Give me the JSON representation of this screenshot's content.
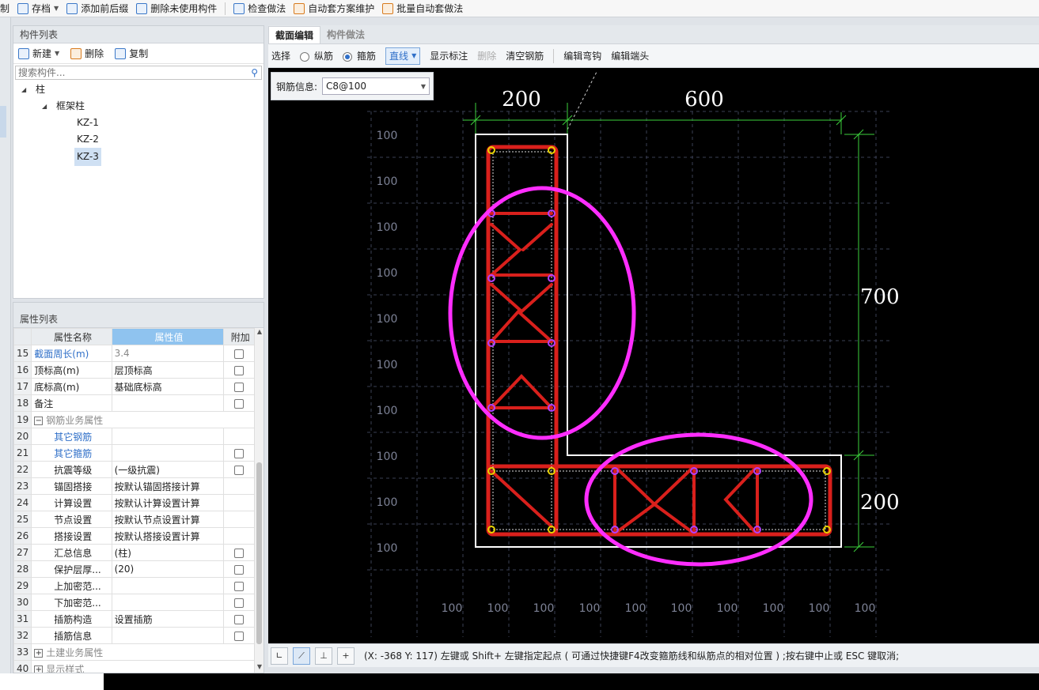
{
  "toolbar": {
    "items": [
      "制",
      "存档",
      "添加前后缀",
      "删除未使用构件",
      "检查做法",
      "自动套方案维护",
      "批量自动套做法"
    ]
  },
  "component_list": {
    "title": "构件列表",
    "new_label": "新建",
    "delete_label": "删除",
    "copy_label": "复制",
    "search_placeholder": "搜索构件...",
    "tree": {
      "root": "柱",
      "group": "框架柱",
      "items": [
        "KZ-1",
        "KZ-2",
        "KZ-3"
      ],
      "selected": "KZ-3"
    }
  },
  "property_list": {
    "title": "属性列表",
    "col_name": "属性名称",
    "col_value": "属性值",
    "col_extra": "附加",
    "rows": [
      {
        "n": "15",
        "name": "截面周长(m)",
        "value": "3.4"
      },
      {
        "n": "16",
        "name": "顶标高(m)",
        "value": "层顶标高"
      },
      {
        "n": "17",
        "name": "底标高(m)",
        "value": "基础底标高"
      },
      {
        "n": "18",
        "name": "备注",
        "value": ""
      },
      {
        "n": "19",
        "name": "钢筋业务属性",
        "value": ""
      },
      {
        "n": "20",
        "name": "其它钢筋",
        "value": ""
      },
      {
        "n": "21",
        "name": "其它箍筋",
        "value": ""
      },
      {
        "n": "22",
        "name": "抗震等级",
        "value": "(一级抗震)"
      },
      {
        "n": "23",
        "name": "锚固搭接",
        "value": "按默认锚固搭接计算"
      },
      {
        "n": "24",
        "name": "计算设置",
        "value": "按默认计算设置计算"
      },
      {
        "n": "25",
        "name": "节点设置",
        "value": "按默认节点设置计算"
      },
      {
        "n": "26",
        "name": "搭接设置",
        "value": "按默认搭接设置计算"
      },
      {
        "n": "27",
        "name": "汇总信息",
        "value": "(柱)"
      },
      {
        "n": "28",
        "name": "保护层厚...",
        "value": "(20)"
      },
      {
        "n": "29",
        "name": "上加密范...",
        "value": ""
      },
      {
        "n": "30",
        "name": "下加密范...",
        "value": ""
      },
      {
        "n": "31",
        "name": "插筋构造",
        "value": "设置插筋"
      },
      {
        "n": "32",
        "name": "插筋信息",
        "value": ""
      },
      {
        "n": "33",
        "name": "土建业务属性",
        "value": ""
      },
      {
        "n": "40",
        "name": "显示样式",
        "value": ""
      }
    ]
  },
  "tabs": {
    "section_edit": "截面编辑",
    "component_method": "构件做法"
  },
  "edit_bar": {
    "select": "选择",
    "longitudinal": "纵筋",
    "stirrup": "箍筋",
    "line_mode": "直线",
    "show_labels": "显示标注",
    "delete": "删除",
    "clear": "清空钢筋",
    "edit_hook": "编辑弯钩",
    "edit_end": "编辑端头"
  },
  "rebar_info": {
    "label": "钢筋信息:",
    "value": "C8@100"
  },
  "drawing": {
    "dim_top_left": "200",
    "dim_top_right": "600",
    "dim_right_top": "700",
    "dim_right_bottom": "200",
    "grid_label": "100"
  },
  "status": {
    "text": "(X: -368 Y: 117)  左键或 Shift+ 左键指定起点 ( 可通过快捷键F4改变箍筋线和纵筋点的相对位置 ) ;按右键中止或 ESC 键取消;"
  },
  "colors": {
    "rebar": "#d9201c",
    "highlight": "#ff2dff",
    "dim": "#3ccf3c",
    "outline": "#ffffff",
    "accent": "#2f6fc8"
  }
}
